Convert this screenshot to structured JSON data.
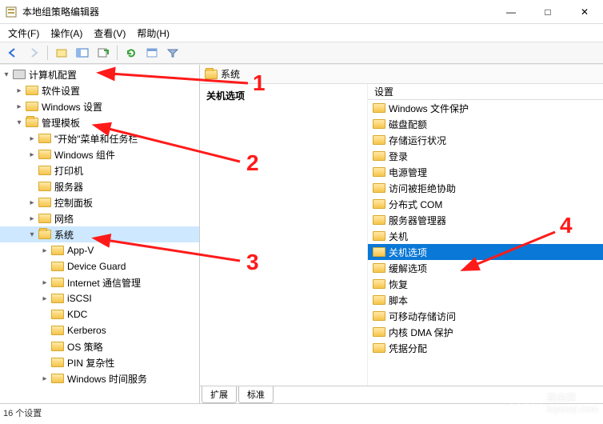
{
  "window": {
    "title": "本地组策略编辑器",
    "controls": {
      "min": "—",
      "max": "□",
      "close": "✕"
    }
  },
  "menu": {
    "file": "文件(F)",
    "action": "操作(A)",
    "view": "查看(V)",
    "help": "帮助(H)"
  },
  "tree": {
    "root": "计算机配置",
    "n1": "软件设置",
    "n2": "Windows 设置",
    "n3": "管理模板",
    "n3_1": "\"开始\"菜单和任务栏",
    "n3_2": "Windows 组件",
    "n3_3": "打印机",
    "n3_4": "服务器",
    "n3_5": "控制面板",
    "n3_6": "网络",
    "n3_7": "系统",
    "n3_7_1": "App-V",
    "n3_7_2": "Device Guard",
    "n3_7_3": "Internet 通信管理",
    "n3_7_4": "iSCSI",
    "n3_7_5": "KDC",
    "n3_7_6": "Kerberos",
    "n3_7_7": "OS 策略",
    "n3_7_8": "PIN 复杂性",
    "n3_7_9": "Windows 时间服务"
  },
  "right": {
    "path": "系统",
    "panel_header": "关机选项",
    "column": "设置",
    "items": [
      "Windows 文件保护",
      "磁盘配额",
      "存储运行状况",
      "登录",
      "电源管理",
      "访问被拒绝协助",
      "分布式 COM",
      "服务器管理器",
      "关机",
      "关机选项",
      "缓解选项",
      "恢复",
      "脚本",
      "可移动存储访问",
      "内核 DMA 保护",
      "凭据分配"
    ],
    "selected_index": 9
  },
  "tabs": {
    "ext": "扩展",
    "std": "标准"
  },
  "status": "16 个设置",
  "annotations": {
    "a1": "1",
    "a2": "2",
    "a3": "3",
    "a4": "4"
  },
  "watermark": {
    "line1": "路由器",
    "line2": "luyouqi.com"
  }
}
